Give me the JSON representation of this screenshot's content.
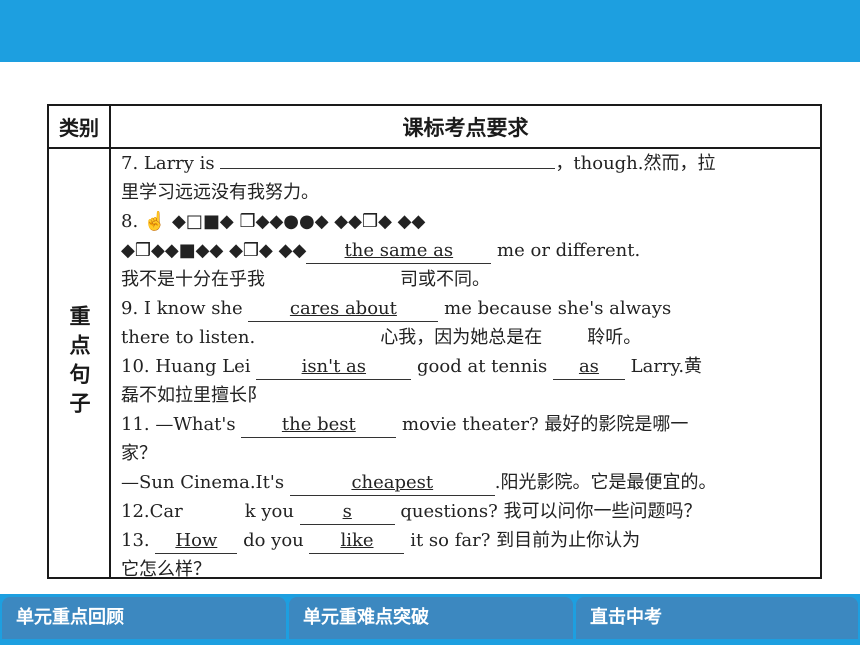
{
  "table": {
    "header_category": "类别",
    "header_title": "课标考点要求",
    "side_label": "重点句子"
  },
  "lines": {
    "l1a": "7. Larry is ",
    "l1b": "，though.然而，拉",
    "l2": "里学习远远没有我努力。",
    "l3a": "8. ",
    "l3b": "☝ ◆□■◆ ❒◆◆●●◆ ◆◆❒◆ ◆◆",
    "l4a": "◆❒◆◆■◆◆ ◆❒◆ ◆◆",
    "l4_ans": "the  same  as",
    "l4b": " me or different.",
    "l5a": "我不是十分在乎我",
    "l5b": "司或不同。",
    "l6a": "9. I know she ",
    "l6_ans": "cares  about",
    "l6b": " me because she's always",
    "l7a": "there to listen.",
    "l7b": "心我，因为她总是在",
    "l7c": "聆听。",
    "l8a": "10. Huang Lei ",
    "l8_ans1": "isn't  as",
    "l8b": " good at tennis ",
    "l8_ans2": "as",
    "l8c": " Larry.黄",
    "l9": "磊不如拉里擅长阝",
    "l10a": "11. —What's ",
    "l10_ans": "the  best",
    "l10b": " movie theater? 最好的影院是哪一",
    "l11": "家？",
    "l12a": "—Sun Cinema.It's ",
    "l12_ans": "cheapest",
    "l12b": ".阳光影院。它是最便宜的。",
    "l13a": "12.Car",
    "l13b": "k you ",
    "l13_ans": "s",
    "l13c": " questions?  我可以问你一些问题吗？",
    "l14a": "13. ",
    "l14_ans1": "How",
    "l14b": " do you ",
    "l14_ans2": "like",
    "l14c": " it so far?     到目前为止你认为",
    "l15": "它怎么样？"
  },
  "nav": {
    "tab1": "单元重点回顾",
    "tab2": "单元重难点突破",
    "tab3": "直击中考"
  },
  "colors": {
    "bar": "#1d9fe0",
    "tab": "#3c88c0"
  }
}
